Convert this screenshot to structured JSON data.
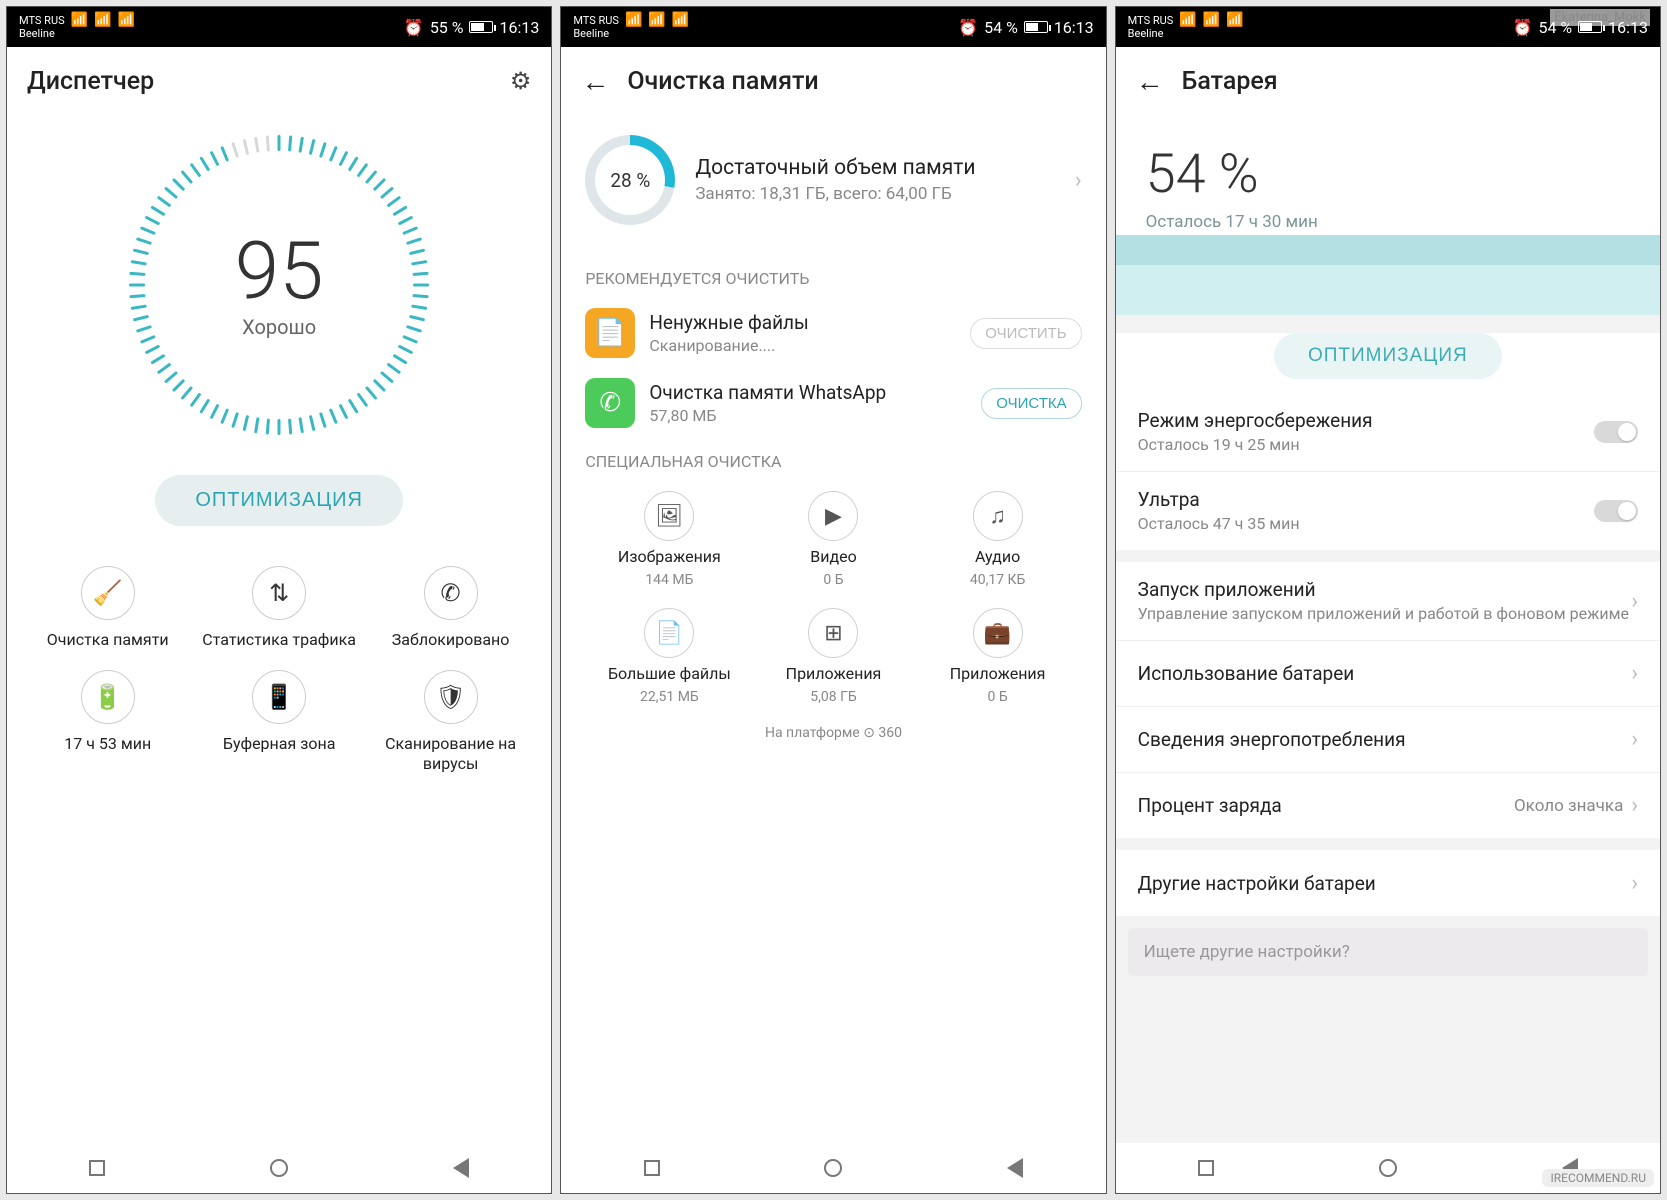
{
  "statusbar": {
    "carrier1": "MTS RUS",
    "carrier2": "Beeline",
    "alarm_icon": "⏰",
    "battery1": "55 %",
    "battery2": "54 %",
    "battery3": "54 %",
    "time": "16:13"
  },
  "watermark_top": "Ekaterina_Mokk",
  "watermark_bottom": "IRECOMMEND.RU",
  "screen1": {
    "title": "Диспетчер",
    "score": "95",
    "score_label": "Хорошо",
    "optimize_btn": "ОПТИМИЗАЦИЯ",
    "tools": [
      {
        "icon": "🧹",
        "label": "Очистка памяти"
      },
      {
        "icon": "⇅",
        "label": "Статистика трафика"
      },
      {
        "icon": "✆",
        "label": "Заблокировано"
      },
      {
        "icon": "🔋",
        "label": "17 ч 53 мин"
      },
      {
        "icon": "📱",
        "label": "Буферная зона"
      },
      {
        "icon": "🛡",
        "label": "Сканирование на вирусы"
      }
    ]
  },
  "screen2": {
    "title": "Очистка памяти",
    "mem_pct": "28 %",
    "mem_title": "Достаточный объем памяти",
    "mem_sub": "Занято: 18,31 ГБ, всего: 64,00 ГБ",
    "rec_header": "РЕКОМЕНДУЕТСЯ ОЧИСТИТЬ",
    "rec": [
      {
        "title": "Ненужные файлы",
        "sub": "Сканирование....",
        "btn": "ОЧИСТИТЬ",
        "disabled": true
      },
      {
        "title": "Очистка памяти WhatsApp",
        "sub": "57,80 МБ",
        "btn": "ОЧИСТКА",
        "disabled": false
      }
    ],
    "spec_header": "СПЕЦИАЛЬНАЯ ОЧИСТКА",
    "spec": [
      {
        "icon": "🖼",
        "title": "Изображения",
        "sub": "144 МБ"
      },
      {
        "icon": "▶",
        "title": "Видео",
        "sub": "0 Б"
      },
      {
        "icon": "♫",
        "title": "Аудио",
        "sub": "40,17 КБ"
      },
      {
        "icon": "📄",
        "title": "Большие файлы",
        "sub": "22,51 МБ"
      },
      {
        "icon": "⊞",
        "title": "Приложения",
        "sub": "5,08 ГБ"
      },
      {
        "icon": "💼",
        "title": "Приложения",
        "sub": "0 Б"
      }
    ],
    "platform": "На платформе ⊙ 360"
  },
  "screen3": {
    "title": "Батарея",
    "pct": "54 %",
    "remaining": "Осталось 17 ч 30 мин",
    "optimize_btn": "ОПТИМИЗАЦИЯ",
    "toggles": [
      {
        "title": "Режим энергосбережения",
        "sub": "Осталось 19 ч 25 мин"
      },
      {
        "title": "Ультра",
        "sub": "Осталось 47 ч 35 мин"
      }
    ],
    "rows": [
      {
        "title": "Запуск приложений",
        "sub": "Управление запуском приложений и работой в фоновом режиме"
      },
      {
        "title": "Использование батареи"
      },
      {
        "title": "Сведения энергопотребления"
      },
      {
        "title": "Процент заряда",
        "val": "Около значка"
      }
    ],
    "other": "Другие настройки батареи",
    "search_placeholder": "Ищете другие настройки?"
  }
}
